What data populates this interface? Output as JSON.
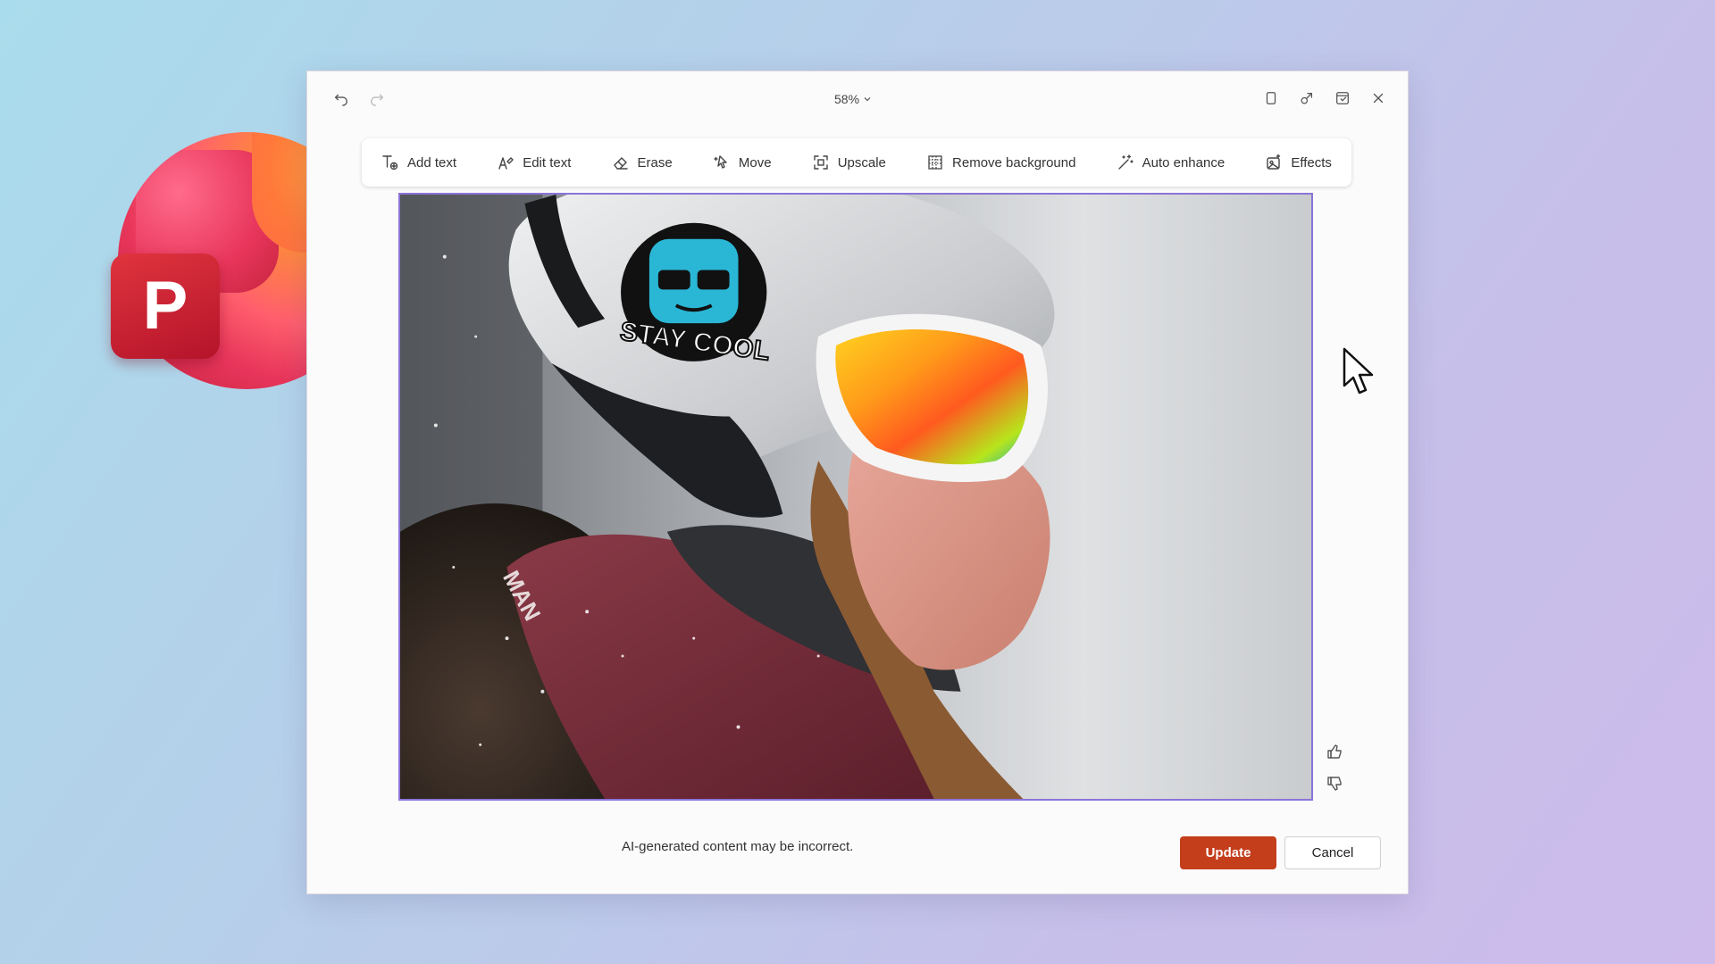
{
  "app": {
    "logo_letter": "P",
    "logo_icon": "powerpoint-logo"
  },
  "titlebar": {
    "undo_icon": "undo-icon",
    "redo_icon": "redo-icon",
    "zoom_level": "58%",
    "right_icons": [
      "copy-icon",
      "share-icon",
      "insert-icon",
      "close-icon"
    ]
  },
  "toolbar": {
    "items": [
      {
        "label": "Add text",
        "icon": "add-text-icon"
      },
      {
        "label": "Edit text",
        "icon": "edit-text-icon"
      },
      {
        "label": "Erase",
        "icon": "eraser-icon"
      },
      {
        "label": "Move",
        "icon": "move-icon"
      },
      {
        "label": "Upscale",
        "icon": "upscale-icon"
      },
      {
        "label": "Remove background",
        "icon": "remove-background-icon"
      },
      {
        "label": "Auto enhance",
        "icon": "magic-wand-icon"
      },
      {
        "label": "Effects",
        "icon": "effects-icon"
      }
    ]
  },
  "image": {
    "sticker_text": "STAY COOL",
    "jacket_text": "MAN"
  },
  "footer": {
    "disclaimer": "AI-generated content may be incorrect.",
    "update_label": "Update",
    "cancel_label": "Cancel"
  },
  "colors": {
    "accent": "#c43e1c",
    "selection_border": "#8b74d8"
  }
}
